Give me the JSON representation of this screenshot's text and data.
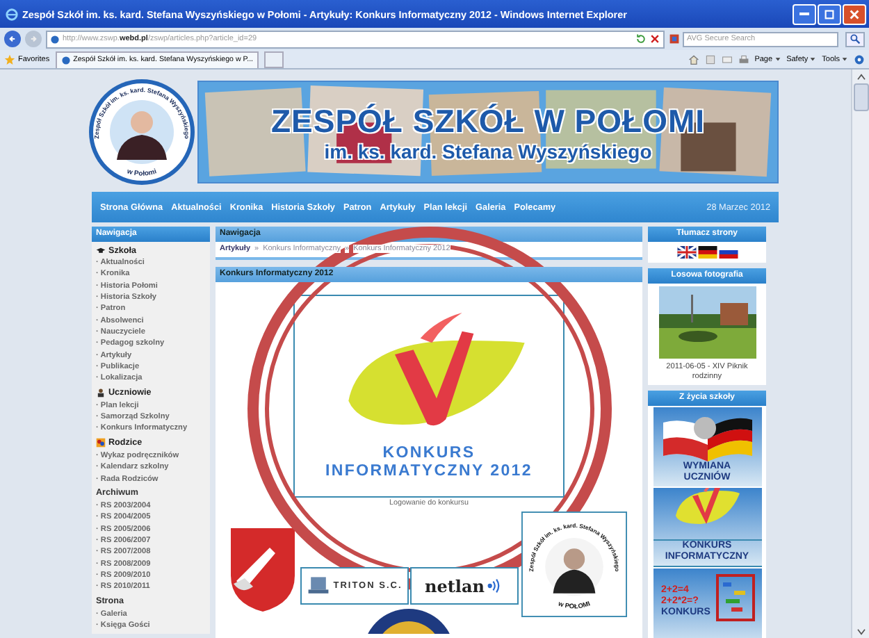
{
  "window": {
    "title": "Zespół Szkół im. ks. kard. Stefana Wyszyńskiego w Połomi - Artykuły: Konkurs Informatyczny 2012 - Windows Internet Explorer"
  },
  "address_bar": {
    "url_prefix": "http://www.zswp.",
    "url_domain": "webd.pl",
    "url_path": "/zswp/articles.php?article_id=29",
    "search_placeholder": "AVG Secure Search"
  },
  "favorites_bar": {
    "label": "Favorites",
    "tab": "Zespół Szkół im. ks. kard. Stefana Wyszyńskiego w P...",
    "commands": [
      "Page",
      "Safety",
      "Tools"
    ]
  },
  "site": {
    "logo_ring": "Zespół Szkół im. ks. kard. Stefana Wyszyńskiego",
    "logo_bottom": "w Połomi",
    "title": "ZESPÓŁ SZKÓŁ W POŁOMI",
    "subtitle": "im. ks. kard. Stefana Wyszyńskiego",
    "nav": [
      "Strona Główna",
      "Aktualności",
      "Kronika",
      "Historia Szkoły",
      "Patron",
      "Artykuły",
      "Plan lekcji",
      "Galeria",
      "Polecamy"
    ],
    "date": "28 Marzec 2012"
  },
  "sidebar": {
    "title": "Nawigacja",
    "sections": [
      {
        "title": "Szkoła",
        "kind": "with_icon",
        "items": [
          "· Aktualności",
          "· Kronika",
          "· Historia Połomi",
          "· Historia Szkoły",
          "· Patron",
          "· Absolwenci",
          "· Nauczyciele",
          "· Pedagog szkolny",
          "· Artykuły",
          "· Publikacje",
          "· Lokalizacja"
        ]
      },
      {
        "title": "Uczniowie",
        "kind": "with_icon",
        "items": [
          "· Plan lekcji",
          "· Samorząd Szkolny",
          "· Konkurs Informatyczny"
        ]
      },
      {
        "title": "Rodzice",
        "kind": "with_icon",
        "items": [
          "· Wykaz podręczników",
          "· Kalendarz szkolny",
          "· Rada Rodziców"
        ]
      },
      {
        "title": "Archiwum",
        "kind": "plain",
        "items": [
          "· RS 2003/2004",
          "· RS 2004/2005",
          "· RS 2005/2006",
          "· RS 2006/2007",
          "· RS 2007/2008",
          "· RS 2008/2009",
          "· RS 2009/2010",
          "· RS 2010/2011"
        ]
      },
      {
        "title": "Strona",
        "kind": "plain",
        "items": [
          "· Galeria",
          "· Księga Gości"
        ]
      }
    ]
  },
  "content": {
    "nav_title": "Nawigacja",
    "breadcrumb": [
      "Artykuły",
      "»",
      "Konkurs Informatyczny",
      "»",
      "Konkurs Informatyczny 2012"
    ],
    "article_title": "Konkurs Informatyczny 2012",
    "logo_lines": [
      "KONKURS",
      "INFORMATYCZNY 2012"
    ],
    "caption": "Logowanie do konkursu",
    "sponsors": [
      {
        "kind": "triton",
        "text": "TRITON S.C."
      },
      {
        "kind": "netlan",
        "text": "netlan"
      }
    ],
    "badge_ring": "Zespół Szkół im. ks. kard. Stefana Wyszyńskiego",
    "badge_bottom": "w POŁOMI"
  },
  "right": {
    "translate_title": "Tłumacz strony",
    "photo_title": "Losowa fotografia",
    "photo_caption": "2011-06-05 - XIV Piknik rodzinny",
    "life_title": "Z życia szkoły",
    "banners": [
      {
        "kind": "exchange",
        "lines": [
          "WYMIANA",
          "UCZNIÓW"
        ]
      },
      {
        "kind": "contest",
        "lines": [
          "KONKURS",
          "INFORMATYCZNY"
        ]
      },
      {
        "kind": "math",
        "lines": [
          "2+2=4",
          "2+2*2=?",
          "KONKURS"
        ]
      }
    ]
  },
  "annotation": {
    "kind": "double_ring"
  }
}
